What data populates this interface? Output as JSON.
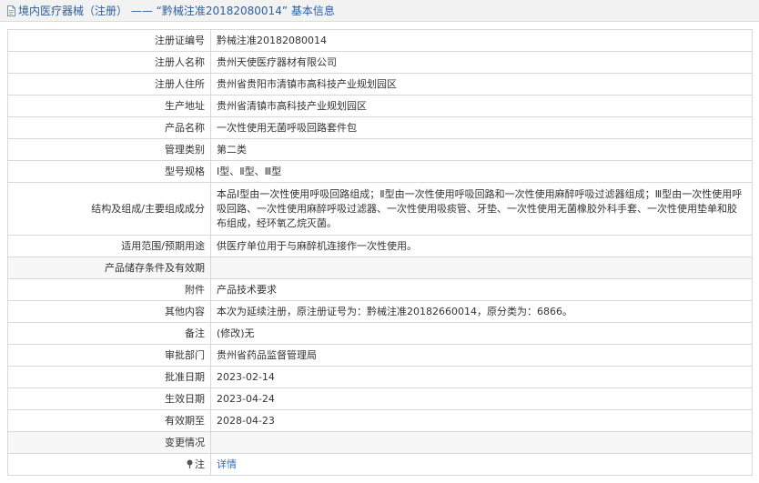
{
  "header": {
    "title": "境内医疗器械（注册） —— “黔械注准20182080014” 基本信息",
    "icon": "document-icon"
  },
  "rows": [
    {
      "label": "注册证编号",
      "value": "黔械注准20182080014"
    },
    {
      "label": "注册人名称",
      "value": "贵州天使医疗器材有限公司"
    },
    {
      "label": "注册人住所",
      "value": "贵州省贵阳市清镇市高科技产业规划园区"
    },
    {
      "label": "生产地址",
      "value": "贵州省清镇市高科技产业规划园区"
    },
    {
      "label": "产品名称",
      "value": "一次性使用无菌呼吸回路套件包"
    },
    {
      "label": "管理类别",
      "value": "第二类"
    },
    {
      "label": "型号规格",
      "value": "Ⅰ型、Ⅱ型、Ⅲ型"
    },
    {
      "label": "结构及组成/主要组成成分",
      "value": "本品Ⅰ型由一次性使用呼吸回路组成；Ⅱ型由一次性使用呼吸回路和一次性使用麻醉呼吸过滤器组成；Ⅲ型由一次性使用呼吸回路、一次性使用麻醉呼吸过滤器、一次性使用吸痰管、牙垫、一次性使用无菌橡胶外科手套、一次性使用垫单和胶布组成，经环氧乙烷灭菌。"
    },
    {
      "label": "适用范围/预期用途",
      "value": "供医疗单位用于与麻醉机连接作一次性使用。"
    },
    {
      "label": "产品储存条件及有效期",
      "value": ""
    },
    {
      "label": "附件",
      "value": "产品技术要求"
    },
    {
      "label": "其他内容",
      "value": "本次为延续注册，原注册证号为：黔械注准20182660014，原分类为：6866。"
    },
    {
      "label": "备注",
      "value": "(修改)无"
    },
    {
      "label": "审批部门",
      "value": "贵州省药品监督管理局"
    },
    {
      "label": "批准日期",
      "value": "2023-02-14"
    },
    {
      "label": "生效日期",
      "value": "2023-04-24"
    },
    {
      "label": "有效期至",
      "value": "2028-04-23"
    },
    {
      "label": "变更情况",
      "value": ""
    }
  ],
  "note": {
    "label": "注",
    "icon": "pin-icon",
    "link_text": "详情"
  }
}
